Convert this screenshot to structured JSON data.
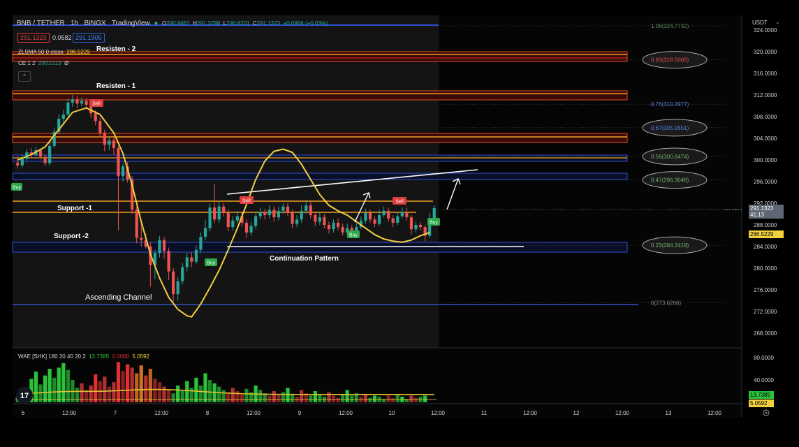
{
  "header": {
    "symbol": "BNB / TETHER",
    "interval": "1h",
    "exchange": "BINGX",
    "source": "TradingView",
    "o_label": "O",
    "o_val": "290.9867",
    "h_label": "H",
    "h_val": "291.3788",
    "l_label": "L",
    "l_val": "290.8201",
    "c_label": "C",
    "c_val": "291.1323",
    "change": "+0.0956 (+0.03%)",
    "sell_price": "291.1323",
    "spread": "0.0582",
    "buy_price": "291.1905"
  },
  "indicators": {
    "zlsma_label": "ZLSMA 50 0 close",
    "zlsma_value": "286.5229",
    "ce_label": "CE 1 2",
    "ce_value": "290.0113",
    "ce_extra": "Ø",
    "wae_label": "WAE [SHK] 180 20 40 20 2",
    "wae_v1": "13.7385",
    "wae_v2": "0.0000",
    "wae_v3": "5.0592"
  },
  "price_axis": {
    "currency": "USDT",
    "ticks": [
      "324.0000",
      "320.0000",
      "316.0000",
      "312.0000",
      "308.0000",
      "304.0000",
      "300.0000",
      "296.0000",
      "292.0000",
      "288.0000",
      "284.0000",
      "280.0000",
      "276.0000",
      "272.0000",
      "268.0000"
    ],
    "current_price": "291.1323",
    "countdown": "41:13",
    "zlsma_tag": "286.5229"
  },
  "wae_axis": {
    "ticks": [
      "80.0000",
      "40.0000"
    ],
    "tag1": "13.7385",
    "tag2": "5.0592"
  },
  "time_axis": [
    "6",
    "12:00",
    "7",
    "12:00",
    "8",
    "12:00",
    "9",
    "12:00",
    "10",
    "12:00",
    "11",
    "12:00",
    "12",
    "12:00",
    "13",
    "12:00"
  ],
  "annotations": {
    "resisten2": "Resisten - 2",
    "resisten1": "Resisten - 1",
    "support1": "Support -1",
    "support2": "Support -2",
    "continuation": "Continuation Pattern",
    "ascending": "Ascending Channel"
  },
  "fib_levels": [
    {
      "label": "1.06(324.7732)",
      "price": 324.7732,
      "boxed": false,
      "color": "#5b8c5a"
    },
    {
      "label": "0.93(318.5005)",
      "price": 318.5005,
      "boxed": true,
      "color": "#e05050"
    },
    {
      "label": "0.76(310.2977)",
      "price": 310.2977,
      "boxed": false,
      "color": "#5080e0"
    },
    {
      "label": "0.67(305.9551)",
      "price": 305.9551,
      "boxed": true,
      "color": "#5080e0"
    },
    {
      "label": "0.56(300.6474)",
      "price": 300.6474,
      "boxed": true,
      "color": "#70b070"
    },
    {
      "label": "0.47(296.3048)",
      "price": 296.3048,
      "boxed": true,
      "color": "#70b070"
    },
    {
      "label": "0.22(284.2419)",
      "price": 284.2419,
      "boxed": true,
      "color": "#70b070"
    },
    {
      "label": "0(273.6266)",
      "price": 273.6266,
      "boxed": false,
      "color": "#888888"
    }
  ],
  "signals": {
    "sell": "Sell",
    "buy": "Buy"
  },
  "chart_data": {
    "type": "candlestick",
    "yrange": [
      266,
      326
    ],
    "candles": [
      [
        299.5,
        299.0,
        300.6,
        298.4
      ],
      [
        299.0,
        300.2,
        301.0,
        298.6
      ],
      [
        300.2,
        301.4,
        302.0,
        299.8
      ],
      [
        301.4,
        300.9,
        302.2,
        300.4
      ],
      [
        300.9,
        301.8,
        302.4,
        300.6
      ],
      [
        301.8,
        300.6,
        302.0,
        300.1
      ],
      [
        300.6,
        299.4,
        301.0,
        298.9
      ],
      [
        299.4,
        302.6,
        303.2,
        299.0
      ],
      [
        302.6,
        305.2,
        306.0,
        302.2
      ],
      [
        305.2,
        307.6,
        308.4,
        304.8
      ],
      [
        307.6,
        308.4,
        309.2,
        306.8
      ],
      [
        308.4,
        310.6,
        311.4,
        308.0
      ],
      [
        310.6,
        311.2,
        312.0,
        309.8
      ],
      [
        311.2,
        310.4,
        311.8,
        309.6
      ],
      [
        310.4,
        310.9,
        311.6,
        309.9
      ],
      [
        310.9,
        310.2,
        311.4,
        309.4
      ],
      [
        310.2,
        308.6,
        310.6,
        307.8
      ],
      [
        308.6,
        307.2,
        309.2,
        306.4
      ],
      [
        307.2,
        305.0,
        307.8,
        304.2
      ],
      [
        305.0,
        302.8,
        305.6,
        301.6
      ],
      [
        302.8,
        303.6,
        304.4,
        301.8
      ],
      [
        303.6,
        302.2,
        304.0,
        301.0
      ],
      [
        302.2,
        297.0,
        302.6,
        287.0
      ],
      [
        297.0,
        298.8,
        299.4,
        296.0
      ],
      [
        298.8,
        296.4,
        299.6,
        295.8
      ],
      [
        296.4,
        290.8,
        297.0,
        290.0
      ],
      [
        290.8,
        285.6,
        291.4,
        284.6
      ],
      [
        285.6,
        285.2,
        288.2,
        284.0
      ],
      [
        285.2,
        284.0,
        286.4,
        283.6
      ],
      [
        284.0,
        280.6,
        284.8,
        276.6
      ],
      [
        280.6,
        282.8,
        283.4,
        278.0
      ],
      [
        282.8,
        285.2,
        286.0,
        282.0
      ],
      [
        285.2,
        283.2,
        285.8,
        281.8
      ],
      [
        283.2,
        279.4,
        283.8,
        277.8
      ],
      [
        279.4,
        275.2,
        280.0,
        273.8
      ],
      [
        275.2,
        277.6,
        278.4,
        274.0
      ],
      [
        277.6,
        280.2,
        281.0,
        277.0
      ],
      [
        280.2,
        282.0,
        282.8,
        279.4
      ],
      [
        282.0,
        281.2,
        283.0,
        280.2
      ],
      [
        281.2,
        283.4,
        284.2,
        280.8
      ],
      [
        283.4,
        285.8,
        286.6,
        282.8
      ],
      [
        285.8,
        287.4,
        289.0,
        285.2
      ],
      [
        287.4,
        291.2,
        292.0,
        286.8
      ],
      [
        291.2,
        289.0,
        295.6,
        288.4
      ],
      [
        289.0,
        291.4,
        292.2,
        288.4
      ],
      [
        291.4,
        290.2,
        292.0,
        289.6
      ],
      [
        290.2,
        287.6,
        290.8,
        286.8
      ],
      [
        287.6,
        288.8,
        289.6,
        287.0
      ],
      [
        288.8,
        289.6,
        290.6,
        288.2
      ],
      [
        289.6,
        288.4,
        290.2,
        287.8
      ],
      [
        288.4,
        286.6,
        289.0,
        285.6
      ],
      [
        286.6,
        287.8,
        288.6,
        286.0
      ],
      [
        287.8,
        289.6,
        290.2,
        287.2
      ],
      [
        289.6,
        290.4,
        291.2,
        289.0
      ],
      [
        290.4,
        289.8,
        291.0,
        289.0
      ],
      [
        289.8,
        290.8,
        291.6,
        289.2
      ],
      [
        290.8,
        289.4,
        291.4,
        288.6
      ],
      [
        289.4,
        290.6,
        291.4,
        288.8
      ],
      [
        290.6,
        291.4,
        292.0,
        290.0
      ],
      [
        291.4,
        290.2,
        292.0,
        289.6
      ],
      [
        290.2,
        288.2,
        290.8,
        287.4
      ],
      [
        288.2,
        289.0,
        289.8,
        287.6
      ],
      [
        289.0,
        290.6,
        291.6,
        288.4
      ],
      [
        290.6,
        291.6,
        292.6,
        290.0
      ],
      [
        291.6,
        289.8,
        292.4,
        289.2
      ],
      [
        289.8,
        288.6,
        290.4,
        287.8
      ],
      [
        288.6,
        289.4,
        290.2,
        288.0
      ],
      [
        289.4,
        288.0,
        290.0,
        287.4
      ],
      [
        288.0,
        287.2,
        288.6,
        286.4
      ],
      [
        287.2,
        288.4,
        289.0,
        286.6
      ],
      [
        288.4,
        287.6,
        289.2,
        287.0
      ],
      [
        287.6,
        286.6,
        288.2,
        286.0
      ],
      [
        286.6,
        287.4,
        288.2,
        286.0
      ],
      [
        287.4,
        286.8,
        288.0,
        286.2
      ],
      [
        286.8,
        287.6,
        288.4,
        286.2
      ],
      [
        287.6,
        288.8,
        289.6,
        287.2
      ],
      [
        288.8,
        290.2,
        291.0,
        288.2
      ],
      [
        290.2,
        289.0,
        290.8,
        288.4
      ],
      [
        289.0,
        288.2,
        289.6,
        287.6
      ],
      [
        288.2,
        289.8,
        290.8,
        287.8
      ],
      [
        289.8,
        290.6,
        291.4,
        289.4
      ],
      [
        290.6,
        289.2,
        291.2,
        288.6
      ],
      [
        289.2,
        288.4,
        289.8,
        287.6
      ],
      [
        288.4,
        289.6,
        290.4,
        288.0
      ],
      [
        289.6,
        290.4,
        291.2,
        289.2
      ],
      [
        290.4,
        289.4,
        291.2,
        288.8
      ],
      [
        289.4,
        287.2,
        289.8,
        286.2
      ],
      [
        287.2,
        288.0,
        288.6,
        286.6
      ],
      [
        288.0,
        287.6,
        288.4,
        287.0
      ],
      [
        287.6,
        286.0,
        288.0,
        285.0
      ],
      [
        286.0,
        289.2,
        290.2,
        285.6
      ],
      [
        289.2,
        291.1,
        291.6,
        288.8
      ]
    ],
    "zlsma": [
      [
        0,
        300.0
      ],
      [
        3,
        301.0
      ],
      [
        6,
        302.4
      ],
      [
        9,
        305.6
      ],
      [
        12,
        308.8
      ],
      [
        15,
        309.6
      ],
      [
        18,
        308.4
      ],
      [
        21,
        305.0
      ],
      [
        23,
        301.2
      ],
      [
        25,
        295.4
      ],
      [
        27,
        288.6
      ],
      [
        29,
        282.6
      ],
      [
        31,
        278.2
      ],
      [
        33,
        274.6
      ],
      [
        35,
        272.4
      ],
      [
        37,
        271.2
      ],
      [
        38,
        271.0
      ],
      [
        40,
        273.4
      ],
      [
        42,
        276.4
      ],
      [
        44,
        279.6
      ],
      [
        46,
        283.4
      ],
      [
        48,
        287.4
      ],
      [
        50,
        291.8
      ],
      [
        52,
        296.4
      ],
      [
        54,
        299.8
      ],
      [
        56,
        301.6
      ],
      [
        58,
        302.0
      ],
      [
        60,
        301.4
      ],
      [
        62,
        299.2
      ],
      [
        64,
        296.4
      ],
      [
        66,
        293.6
      ],
      [
        68,
        291.6
      ],
      [
        70,
        290.6
      ],
      [
        72,
        289.8
      ],
      [
        74,
        288.6
      ],
      [
        76,
        287.4
      ],
      [
        78,
        286.2
      ],
      [
        80,
        285.4
      ],
      [
        82,
        285.0
      ],
      [
        84,
        284.8
      ],
      [
        86,
        285.2
      ],
      [
        88,
        286.0
      ],
      [
        90,
        286.6
      ]
    ],
    "wae_bars": [
      [
        10,
        "#1f8a2a"
      ],
      [
        18,
        "#1f8a2a"
      ],
      [
        25,
        "#1f8a2a"
      ],
      [
        42,
        "#29c23a"
      ],
      [
        55,
        "#29c23a"
      ],
      [
        32,
        "#1f8a2a"
      ],
      [
        48,
        "#29c23a"
      ],
      [
        60,
        "#29c23a"
      ],
      [
        44,
        "#1f8a2a"
      ],
      [
        62,
        "#29c23a"
      ],
      [
        70,
        "#29c23a"
      ],
      [
        58,
        "#1f8a2a"
      ],
      [
        40,
        "#1f8a2a"
      ],
      [
        26,
        "#1f8a2a"
      ],
      [
        34,
        "#b03030"
      ],
      [
        22,
        "#8a2020"
      ],
      [
        30,
        "#b03030"
      ],
      [
        50,
        "#e03030"
      ],
      [
        38,
        "#8a2020"
      ],
      [
        46,
        "#b03030"
      ],
      [
        28,
        "#8a2020"
      ],
      [
        36,
        "#b03030"
      ],
      [
        72,
        "#e03030"
      ],
      [
        56,
        "#8a2020"
      ],
      [
        68,
        "#e03030"
      ],
      [
        62,
        "#b03030"
      ],
      [
        52,
        "#c06020"
      ],
      [
        66,
        "#d07020"
      ],
      [
        48,
        "#b03030"
      ],
      [
        60,
        "#c06020"
      ],
      [
        42,
        "#8a2020"
      ],
      [
        36,
        "#8a2020"
      ],
      [
        28,
        "#b03030"
      ],
      [
        22,
        "#8a2020"
      ],
      [
        16,
        "#1f8a2a"
      ],
      [
        30,
        "#29c23a"
      ],
      [
        20,
        "#1f8a2a"
      ],
      [
        38,
        "#29c23a"
      ],
      [
        26,
        "#1f8a2a"
      ],
      [
        44,
        "#29c23a"
      ],
      [
        30,
        "#1f8a2a"
      ],
      [
        52,
        "#29c23a"
      ],
      [
        40,
        "#1f8a2a"
      ],
      [
        34,
        "#29c23a"
      ],
      [
        28,
        "#1f8a2a"
      ],
      [
        22,
        "#1f8a2a"
      ],
      [
        18,
        "#8a2020"
      ],
      [
        26,
        "#b03030"
      ],
      [
        20,
        "#8a2020"
      ],
      [
        14,
        "#8a2020"
      ],
      [
        24,
        "#1f8a2a"
      ],
      [
        18,
        "#1f8a2a"
      ],
      [
        30,
        "#29c23a"
      ],
      [
        22,
        "#1f8a2a"
      ],
      [
        16,
        "#1f8a2a"
      ],
      [
        12,
        "#8a2020"
      ],
      [
        20,
        "#b03030"
      ],
      [
        14,
        "#8a2020"
      ],
      [
        18,
        "#1f8a2a"
      ],
      [
        26,
        "#29c23a"
      ],
      [
        14,
        "#1f8a2a"
      ],
      [
        10,
        "#8a2020"
      ],
      [
        22,
        "#b03030"
      ],
      [
        16,
        "#8a2020"
      ],
      [
        12,
        "#1f8a2a"
      ],
      [
        20,
        "#29c23a"
      ],
      [
        14,
        "#1f8a2a"
      ],
      [
        10,
        "#1f8a2a"
      ],
      [
        18,
        "#b03030"
      ],
      [
        12,
        "#8a2020"
      ],
      [
        8,
        "#8a2020"
      ],
      [
        14,
        "#1f8a2a"
      ],
      [
        22,
        "#29c23a"
      ],
      [
        12,
        "#1f8a2a"
      ],
      [
        16,
        "#1f8a2a"
      ],
      [
        10,
        "#8a2020"
      ],
      [
        14,
        "#b03030"
      ],
      [
        8,
        "#1f8a2a"
      ],
      [
        12,
        "#29c23a"
      ],
      [
        10,
        "#1f8a2a"
      ],
      [
        6,
        "#1f8a2a"
      ],
      [
        12,
        "#8a2020"
      ],
      [
        8,
        "#8a2020"
      ],
      [
        14,
        "#1f8a2a"
      ],
      [
        10,
        "#29c23a"
      ],
      [
        6,
        "#1f8a2a"
      ],
      [
        12,
        "#b03030"
      ],
      [
        8,
        "#8a2020"
      ],
      [
        10,
        "#1f8a2a"
      ],
      [
        12,
        "#29c23a"
      ]
    ]
  }
}
